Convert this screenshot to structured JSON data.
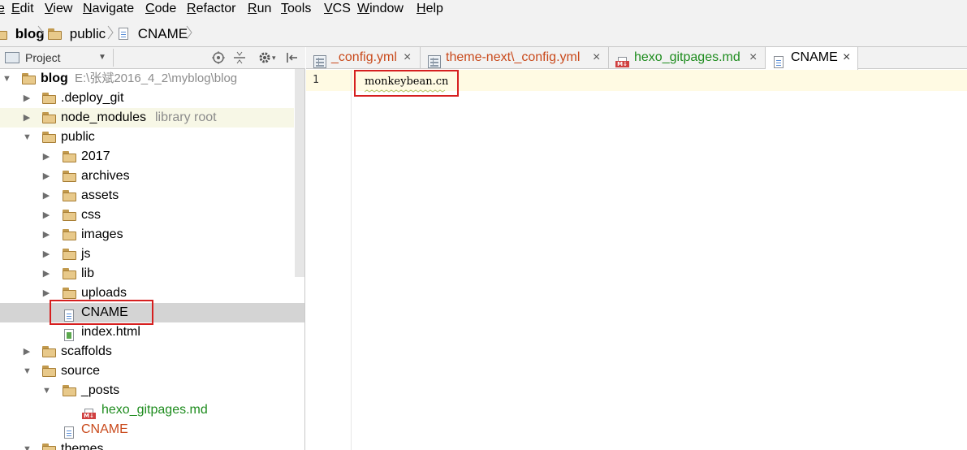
{
  "menu": {
    "items": [
      {
        "mn": "E",
        "rest": "dit"
      },
      {
        "mn": "V",
        "rest": "iew"
      },
      {
        "mn": "N",
        "rest": "avigate"
      },
      {
        "mn": "C",
        "rest": "ode"
      },
      {
        "mn": "R",
        "rest": "efactor"
      },
      {
        "mn": "R",
        "rest": "un"
      },
      {
        "mn": "T",
        "rest": "ools"
      },
      {
        "mn": "V",
        "rest": "CS"
      },
      {
        "mn": "W",
        "rest": "indow"
      },
      {
        "mn": "H",
        "rest": "elp"
      }
    ],
    "leading": "e"
  },
  "breadcrumb": [
    "blog",
    "public",
    "CNAME"
  ],
  "project_panel": {
    "title": "Project",
    "icons": [
      "locate-icon",
      "collapse-icon",
      "settings-icon",
      "hide-icon"
    ]
  },
  "tree": [
    {
      "name": "blog",
      "path": "E:\\张斌2016_4_2\\myblog\\blog",
      "type": "folder",
      "expanded": true
    },
    {
      "name": ".deploy_git",
      "type": "folder",
      "expanded": false
    },
    {
      "name": "node_modules",
      "note": "library root",
      "type": "folder",
      "expanded": false
    },
    {
      "name": "public",
      "type": "folder",
      "expanded": true
    },
    {
      "name": "2017",
      "type": "folder",
      "expanded": false
    },
    {
      "name": "archives",
      "type": "folder",
      "expanded": false
    },
    {
      "name": "assets",
      "type": "folder",
      "expanded": false
    },
    {
      "name": "css",
      "type": "folder",
      "expanded": false
    },
    {
      "name": "images",
      "type": "folder",
      "expanded": false
    },
    {
      "name": "js",
      "type": "folder",
      "expanded": false
    },
    {
      "name": "lib",
      "type": "folder",
      "expanded": false
    },
    {
      "name": "uploads",
      "type": "folder",
      "expanded": false
    },
    {
      "name": "CNAME",
      "type": "file",
      "selected": true
    },
    {
      "name": "index.html",
      "type": "html"
    },
    {
      "name": "scaffolds",
      "type": "folder",
      "expanded": false
    },
    {
      "name": "source",
      "type": "folder",
      "expanded": true
    },
    {
      "name": "_posts",
      "type": "folder",
      "expanded": true
    },
    {
      "name": "hexo_gitpages.md",
      "type": "md",
      "status": "added"
    },
    {
      "name": "CNAME",
      "type": "file",
      "status": "modified"
    },
    {
      "name": "themes",
      "type": "folder",
      "expanded": true
    }
  ],
  "tabs": [
    {
      "label": "_config.yml",
      "close": "×",
      "status": "modified"
    },
    {
      "label": "theme-next\\_config.yml",
      "close": "×",
      "status": "modified"
    },
    {
      "label": "hexo_gitpages.md",
      "close": "×",
      "status": "added"
    },
    {
      "label": "CNAME",
      "close": "×",
      "active": true
    }
  ],
  "editor": {
    "line_number": "1",
    "content": "monkeybean.cn"
  },
  "colors": {
    "highlight_box": "#d61f1f",
    "added": "#1e8c1e",
    "modified": "#c94a1c",
    "current_line": "#fffae3"
  }
}
